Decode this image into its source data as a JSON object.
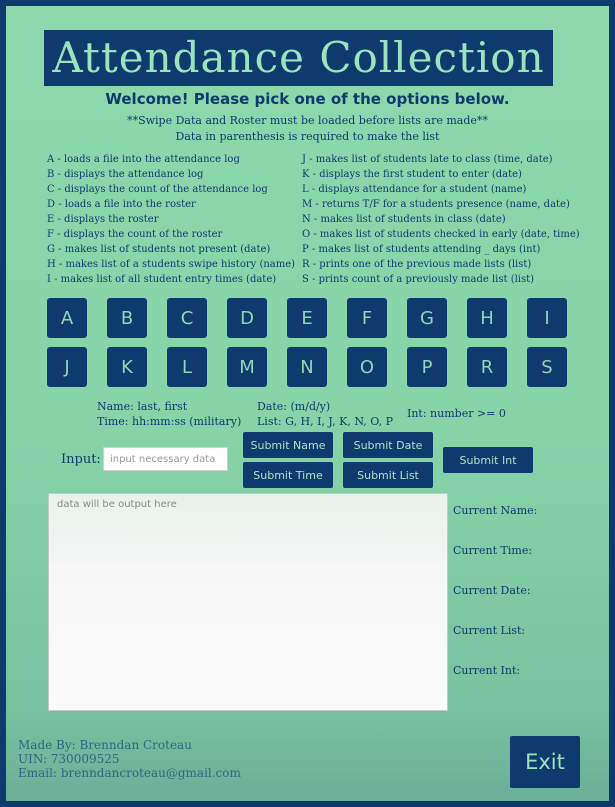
{
  "title": "Attendance Collection",
  "welcome": "Welcome! Please pick one of the options below.",
  "notes": [
    "**Swipe Data and Roster must be loaded before lists are made**",
    "Data in parenthesis is required to make the list"
  ],
  "options_left": [
    "A - loads a file into the attendance log",
    "B - displays the attendance log",
    "C - displays the count of the attendance log",
    "D - loads a file into the roster",
    "E - displays the roster",
    "F - displays the count of the roster",
    "G - makes list of students not present (date)",
    "H - makes list of a students swipe history (name)",
    "I - makes list of all student entry times (date)"
  ],
  "options_right": [
    "J -  makes list of students late to class (time, date)",
    "K - displays the first student to enter (date)",
    "L - displays attendance for a student (name)",
    "M - returns T/F for a students presence (name, date)",
    "N - makes list of students in class (date)",
    "O - makes list of students checked in early (date, time)",
    "P - makes list of students attending _ days (int)",
    "R - prints one of the previous made lists (list)",
    "S - prints count of a previously made list (list)"
  ],
  "keys_row1": [
    "A",
    "B",
    "C",
    "D",
    "E",
    "F",
    "G",
    "H",
    "I"
  ],
  "keys_row2": [
    "J",
    "K",
    "L",
    "M",
    "N",
    "O",
    "P",
    "R",
    "S"
  ],
  "formats": {
    "name": "Name: last, first",
    "time": "Time: hh:mm:ss (military)",
    "date": "Date: (m/d/y)",
    "list": "List: G, H, I, J, K, N, O, P",
    "int": "Int: number >= 0"
  },
  "input": {
    "label": "Input:",
    "placeholder": "input necessary data",
    "value": ""
  },
  "buttons": {
    "submit_name": "Submit Name",
    "submit_date": "Submit Date",
    "submit_int": "Submit Int",
    "submit_time": "Submit Time",
    "submit_list": "Submit List"
  },
  "output_placeholder": "data will be output here",
  "current": {
    "name": "Current Name:",
    "time": "Current Time:",
    "date": "Current Date:",
    "list": "Current List:",
    "int": "Current Int:"
  },
  "footer": {
    "made_by": "Made By: Brenndan Croteau",
    "uin": "UIN: 730009525",
    "email": "Email: brenndancroteau@gmail.com"
  },
  "exit_label": "Exit",
  "colors": {
    "navy": "#0f3a6e",
    "mint": "#8dd9ad",
    "button_text": "#a9e6c6"
  }
}
